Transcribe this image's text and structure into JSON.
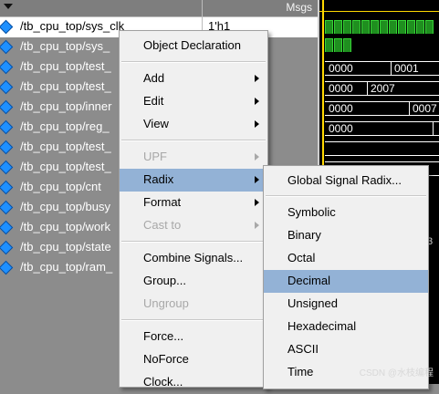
{
  "header": {
    "msgs_label": "Msgs"
  },
  "signals": [
    {
      "name": "/tb_cpu_top/sys_clk",
      "value": "1'h1",
      "selected": true
    },
    {
      "name": "/tb_cpu_top/sys_",
      "value": ""
    },
    {
      "name": "/tb_cpu_top/test_",
      "value": ""
    },
    {
      "name": "/tb_cpu_top/test_",
      "value": ""
    },
    {
      "name": "/tb_cpu_top/inner",
      "value": ""
    },
    {
      "name": "/tb_cpu_top/reg_",
      "value": ""
    },
    {
      "name": "/tb_cpu_top/test_",
      "value": ""
    },
    {
      "name": "/tb_cpu_top/test_",
      "value": ""
    },
    {
      "name": "/tb_cpu_top/cnt",
      "value": ""
    },
    {
      "name": "/tb_cpu_top/busy",
      "value": ""
    },
    {
      "name": "/tb_cpu_top/work",
      "value": ""
    },
    {
      "name": "/tb_cpu_top/state",
      "value": ""
    },
    {
      "name": "/tb_cpu_top/ram_",
      "value": ""
    }
  ],
  "wave": {
    "bus_values": {
      "row2_a": "0000",
      "row2_b": "0001",
      "row3_a": "0000",
      "row3_b": "2007",
      "row4_a": "0000",
      "row4_b": "0007",
      "row5_a": "0000"
    },
    "fragment": "3"
  },
  "context_menu": {
    "items": {
      "object_declaration": "Object Declaration",
      "add": "Add",
      "edit": "Edit",
      "view": "View",
      "upf": "UPF",
      "radix": "Radix",
      "format": "Format",
      "cast_to": "Cast to",
      "combine_signals": "Combine Signals...",
      "group": "Group...",
      "ungroup": "Ungroup",
      "force": "Force...",
      "noforce": "NoForce",
      "clock": "Clock..."
    }
  },
  "radix_menu": {
    "global": "Global Signal Radix...",
    "options": [
      "Symbolic",
      "Binary",
      "Octal",
      "Decimal",
      "Unsigned",
      "Hexadecimal",
      "ASCII",
      "Time"
    ],
    "highlighted": "Decimal"
  },
  "watermark": "CSDN @水枝编程",
  "colors": {
    "highlight": "#93b2d6",
    "signal_icon": "#1e90ff",
    "cursor": "#ffd800",
    "clock_wave": "#36d436"
  }
}
